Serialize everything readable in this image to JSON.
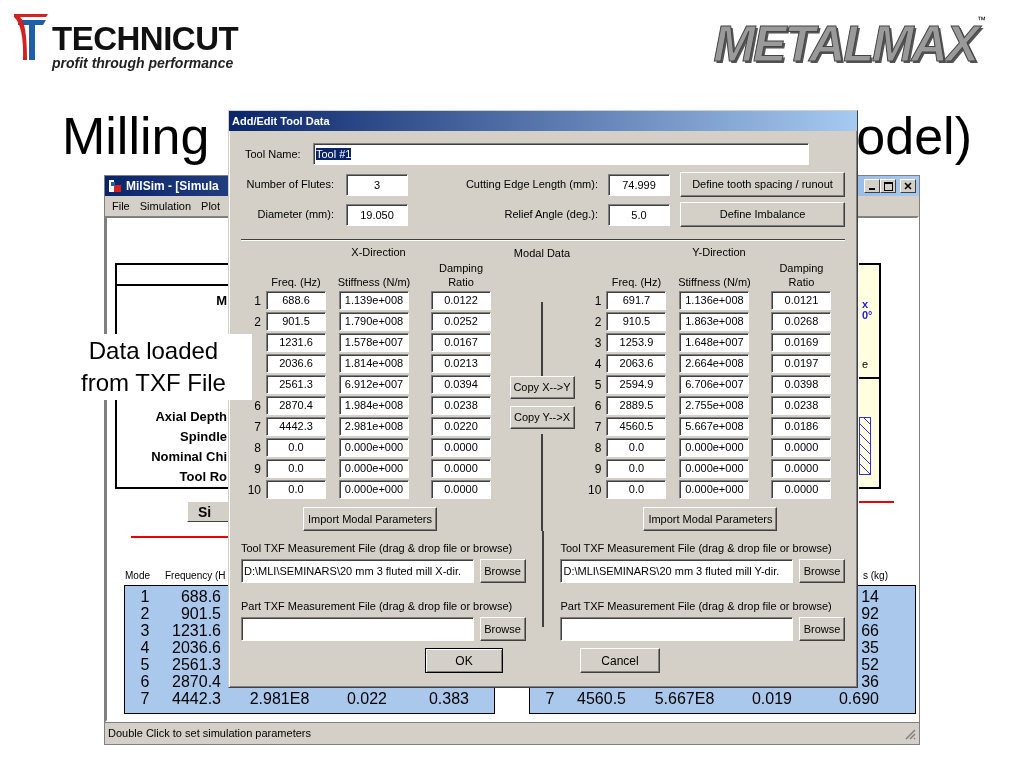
{
  "slide": {
    "logo_left": {
      "name": "TECHNICUT",
      "tagline": "profit through performance"
    },
    "logo_right": {
      "name": "METALMAX",
      "mark": "™"
    },
    "title_parts": [
      "Milling",
      "odel)"
    ]
  },
  "app_window": {
    "title": "MilSim - [Simula",
    "menu": [
      "File",
      "Simulation",
      "Plot"
    ],
    "panel": {
      "heading": "M",
      "labels": [
        "Axial Depth",
        "Spindle",
        "Nominal Chi",
        "Tool Ro"
      ]
    },
    "button": "Si",
    "side_panel_texts": [
      {
        "text": "x",
        "kind": "blue"
      },
      {
        "text": "0°",
        "kind": "blue"
      },
      {
        "text": "e",
        "kind": "plain"
      }
    ],
    "tables": [
      {
        "header": {
          "mode": "Mode",
          "frequency": "Frequency (H"
        },
        "rows": [
          {
            "mode": "1",
            "frequency": "688.6"
          },
          {
            "mode": "2",
            "frequency": "901.5"
          },
          {
            "mode": "3",
            "frequency": "1231.6"
          },
          {
            "mode": "4",
            "frequency": "2036.6"
          },
          {
            "mode": "5",
            "frequency": "2561.3"
          },
          {
            "mode": "6",
            "frequency": "2870.4"
          },
          {
            "mode": "7",
            "frequency": "4442.3",
            "stiffness": "2.981E8",
            "damping": "0.022",
            "mass": "0.383"
          }
        ]
      },
      {
        "header": {
          "mass": "s (kg)"
        },
        "rows": [
          {
            "mass": "14"
          },
          {
            "mass": "92"
          },
          {
            "mass": "66"
          },
          {
            "mass": "35"
          },
          {
            "mass": "52"
          },
          {
            "mass": "36"
          },
          {
            "mode": "7",
            "frequency": "4560.5",
            "stiffness": "5.667E8",
            "damping": "0.019",
            "mass": "0.690"
          }
        ]
      }
    ],
    "status_bar": "Double Click to set simulation parameters"
  },
  "callout": {
    "text": "Data loaded from TXF File"
  },
  "dialog": {
    "title": "Add/Edit Tool Data",
    "tool_name": {
      "label": "Tool Name:",
      "value": "Tool #1",
      "text_selected": true
    },
    "fields": [
      {
        "label": "Number of Flutes:",
        "value": "3"
      },
      {
        "label": "Cutting Edge Length (mm):",
        "value": "74.999"
      },
      {
        "label": "Diameter (mm):",
        "value": "19.050"
      },
      {
        "label": "Relief Angle (deg.):",
        "value": "5.0"
      }
    ],
    "side_buttons": [
      "Define tooth spacing / runout",
      "Define Imbalance"
    ],
    "section_title": "Modal Data",
    "copy_buttons": [
      "Copy X-->Y",
      "Copy Y-->X"
    ],
    "directions": [
      {
        "title": "X-Direction",
        "columns": [
          "Freq. (Hz)",
          "Stiffness (N/m)",
          "Damping Ratio"
        ],
        "rows": [
          {
            "number": "1",
            "values": [
              "688.6",
              "1.139e+008",
              "0.0122"
            ]
          },
          {
            "number": "2",
            "values": [
              "901.5",
              "1.790e+008",
              "0.0252"
            ]
          },
          {
            "values": [
              "1231.6",
              "1.578e+007",
              "0.0167"
            ]
          },
          {
            "values": [
              "2036.6",
              "1.814e+008",
              "0.0213"
            ]
          },
          {
            "values": [
              "2561.3",
              "6.912e+007",
              "0.0394"
            ]
          },
          {
            "number": "6",
            "values": [
              "2870.4",
              "1.984e+008",
              "0.0238"
            ]
          },
          {
            "number": "7",
            "values": [
              "4442.3",
              "2.981e+008",
              "0.0220"
            ]
          },
          {
            "number": "8",
            "values": [
              "0.0",
              "0.000e+000",
              "0.0000"
            ]
          },
          {
            "number": "9",
            "values": [
              "0.0",
              "0.000e+000",
              "0.0000"
            ]
          },
          {
            "number": "10",
            "values": [
              "0.0",
              "0.000e+000",
              "0.0000"
            ]
          }
        ],
        "import_button": "Import Modal Parameters",
        "tool_file": {
          "label": "Tool TXF Measurement File (drag & drop file or browse)",
          "value": "D:\\MLI\\SEMINARS\\20 mm 3 fluted mill X-dir.",
          "button": "Browse"
        },
        "part_file": {
          "label": "Part TXF Measurement File (drag & drop file or browse)",
          "button": "Browse"
        }
      },
      {
        "title": "Y-Direction",
        "columns": [
          "Freq. (Hz)",
          "Stiffness (N/m)",
          "Damping Ratio"
        ],
        "rows": [
          {
            "number": "1",
            "values": [
              "691.7",
              "1.136e+008",
              "0.0121"
            ]
          },
          {
            "number": "2",
            "values": [
              "910.5",
              "1.863e+008",
              "0.0268"
            ]
          },
          {
            "number": "3",
            "values": [
              "1253.9",
              "1.648e+007",
              "0.0169"
            ]
          },
          {
            "number": "4",
            "values": [
              "2063.6",
              "2.664e+008",
              "0.0197"
            ]
          },
          {
            "number": "5",
            "values": [
              "2594.9",
              "6.706e+007",
              "0.0398"
            ]
          },
          {
            "number": "6",
            "values": [
              "2889.5",
              "2.755e+008",
              "0.0238"
            ]
          },
          {
            "number": "7",
            "values": [
              "4560.5",
              "5.667e+008",
              "0.0186"
            ]
          },
          {
            "number": "8",
            "values": [
              "0.0",
              "0.000e+000",
              "0.0000"
            ]
          },
          {
            "number": "9",
            "values": [
              "0.0",
              "0.000e+000",
              "0.0000"
            ]
          },
          {
            "number": "10",
            "values": [
              "0.0",
              "0.000e+000",
              "0.0000"
            ]
          }
        ],
        "import_button": "Import Modal Parameters",
        "tool_file": {
          "label": "Tool TXF Measurement File (drag & drop file or browse)",
          "value": "D:\\MLI\\SEMINARS\\20 mm 3 fluted mill Y-dir.",
          "button": "Browse"
        },
        "part_file": {
          "label": "Part TXF Measurement File (drag & drop file or browse)",
          "button": "Browse"
        }
      }
    ],
    "buttons": [
      "OK",
      "Cancel"
    ]
  }
}
